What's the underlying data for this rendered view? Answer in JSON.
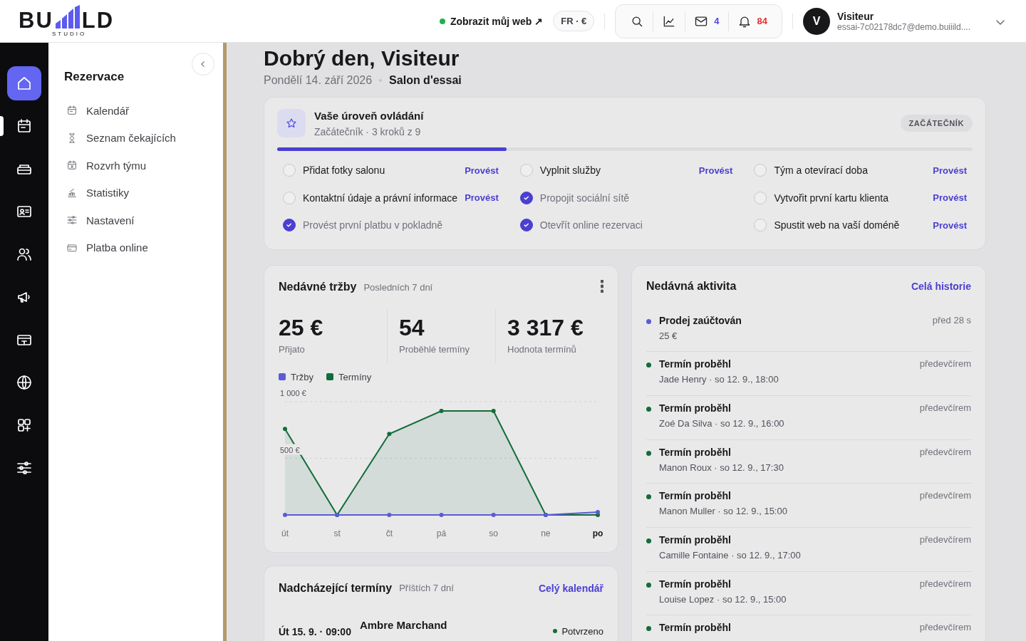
{
  "header": {
    "logo": {
      "left": "BU",
      "right": "LD",
      "tagline": "STUDIO"
    },
    "view_site_link": {
      "label": "Zobrazit můj web ↗",
      "online": true
    },
    "locale": "FR · €",
    "toolbar": {
      "messages_count": "4",
      "notifications_count": "84"
    },
    "user": {
      "avatar": "V",
      "name": "Visiteur",
      "email": "essai-7c02178dc7@demo.buiiild...."
    }
  },
  "rail": [
    {
      "kind": "home",
      "selected": true,
      "current": false
    },
    {
      "kind": "calendar",
      "selected": false,
      "current": true
    },
    {
      "kind": "register",
      "selected": false,
      "current": false
    },
    {
      "kind": "contact",
      "selected": false,
      "current": false
    },
    {
      "kind": "users",
      "selected": false,
      "current": false
    },
    {
      "kind": "megaphone",
      "selected": false,
      "current": false
    },
    {
      "kind": "ticket",
      "selected": false,
      "current": false
    },
    {
      "kind": "globe",
      "selected": false,
      "current": false
    },
    {
      "kind": "apps",
      "selected": false,
      "current": false
    },
    {
      "kind": "sliders",
      "selected": false,
      "current": false
    }
  ],
  "sidebar": {
    "title": "Rezervace",
    "items": [
      {
        "label": "Kalendář",
        "kind": "calendar"
      },
      {
        "label": "Seznam čekajících",
        "kind": "hourglass"
      },
      {
        "label": "Rozvrh týmu",
        "kind": "schedule"
      },
      {
        "label": "Statistiky",
        "kind": "chart"
      },
      {
        "label": "Nastavení",
        "kind": "sliders"
      },
      {
        "label": "Platba online",
        "kind": "card"
      }
    ]
  },
  "greeting": {
    "title": "Dobrý den, Visiteur",
    "date": "Pondělí 14. září 2026",
    "salon": "Salon d'essai"
  },
  "onboarding": {
    "title": "Vaše úroveň ovládání",
    "subtitle": "Začátečník · 3 kroků z 9",
    "badge": "ZAČÁTEČNÍK",
    "level": 0.33,
    "tasks": [
      {
        "label": "Přidat fotky salonu",
        "checked": false,
        "action": "Provést"
      },
      {
        "label": "Vyplnit služby",
        "checked": false,
        "action": "Provést"
      },
      {
        "label": "Tým a otevírací doba",
        "checked": false,
        "action": "Provést"
      },
      {
        "label": "Kontaktní údaje a právní informace",
        "checked": false,
        "action": "Provést"
      },
      {
        "label": "Propojit sociální sítě",
        "checked": true
      },
      {
        "label": "Vytvořit první kartu klienta",
        "checked": false,
        "action": "Provést"
      },
      {
        "label": "Provést první platbu v pokladně",
        "checked": true
      },
      {
        "label": "Otevřít online rezervaci",
        "checked": true
      },
      {
        "label": "Spustit web na vaší doméně",
        "checked": false,
        "action": "Provést"
      }
    ]
  },
  "revenue": {
    "title": "Nedávné tržby",
    "period": "Posledních 7 dní",
    "stats": [
      {
        "value": "25 €",
        "label": "Přijato"
      },
      {
        "value": "54",
        "label": "Proběhlé termíny"
      },
      {
        "value": "3 317 €",
        "label": "Hodnota termínů"
      }
    ],
    "chart_data": {
      "type": "area",
      "categories": [
        "út",
        "st",
        "čt",
        "pá",
        "so",
        "ne",
        "po"
      ],
      "ylim": [
        0,
        1000
      ],
      "yticks": [
        {
          "value": 500,
          "label": "500 €"
        },
        {
          "value": 1000,
          "label": "1 000 €"
        }
      ],
      "series": [
        {
          "name": "Tržby",
          "color": "#5b5bd6",
          "values": [
            0,
            0,
            0,
            0,
            0,
            0,
            25
          ]
        },
        {
          "name": "Termíny",
          "color": "#136c3a",
          "values": [
            760,
            0,
            715,
            918,
            918,
            0,
            0
          ]
        }
      ]
    }
  },
  "activity": {
    "title": "Nedávná aktivita",
    "link": "Celá historie",
    "items": [
      {
        "title": "Prodej zaúčtován",
        "detail": "25 €",
        "time": "před 28 s",
        "color": "#5b5bd6"
      },
      {
        "title": "Termín proběhl",
        "detail": "Jade Henry · so 12. 9., 18:00",
        "time": "předevčírem",
        "color": "#136c3a"
      },
      {
        "title": "Termín proběhl",
        "detail": "Zoé Da Silva · so 12. 9., 16:00",
        "time": "předevčírem",
        "color": "#136c3a"
      },
      {
        "title": "Termín proběhl",
        "detail": "Manon Roux · so 12. 9., 17:30",
        "time": "předevčírem",
        "color": "#136c3a"
      },
      {
        "title": "Termín proběhl",
        "detail": "Manon Muller · so 12. 9., 15:00",
        "time": "předevčírem",
        "color": "#136c3a"
      },
      {
        "title": "Termín proběhl",
        "detail": "Camille Fontaine · so 12. 9., 17:00",
        "time": "předevčírem",
        "color": "#136c3a"
      },
      {
        "title": "Termín proběhl",
        "detail": "Louise Lopez · so 12. 9., 15:00",
        "time": "předevčírem",
        "color": "#136c3a"
      },
      {
        "title": "Termín proběhl",
        "time": "předevčírem",
        "color": "#136c3a"
      }
    ]
  },
  "upcoming": {
    "title": "Nadcházející termíny",
    "period": "Příštích 7 dní",
    "link": "Celý kalendář",
    "items": [
      {
        "time": "Út 15. 9. · 09:00",
        "name": "Ambre Marchand",
        "status": "Potvrzeno",
        "color": "#136c3a"
      }
    ]
  }
}
